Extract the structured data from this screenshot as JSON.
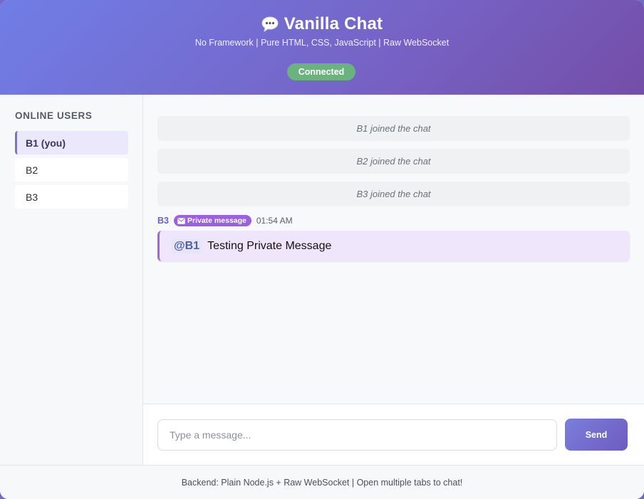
{
  "header": {
    "icon": "speech-bubble-icon",
    "title": "Vanilla Chat",
    "subtitle": "No Framework | Pure HTML, CSS, JavaScript | Raw WebSocket",
    "status": "Connected",
    "status_color": "#6ab37f"
  },
  "sidebar": {
    "heading": "ONLINE USERS",
    "users": [
      {
        "label": "B1 (you)",
        "active": true
      },
      {
        "label": "B2",
        "active": false
      },
      {
        "label": "B3",
        "active": false
      }
    ]
  },
  "messages": {
    "system": [
      "B1 joined the chat",
      "B2 joined the chat",
      "B3 joined the chat"
    ],
    "private": {
      "author": "B3",
      "badge_icon": "envelope-icon",
      "badge": "Private message",
      "time": "01:54 AM",
      "mention": "@B1",
      "text": "Testing Private Message"
    }
  },
  "composer": {
    "placeholder": "Type a message...",
    "value": "",
    "send_label": "Send"
  },
  "footer": {
    "text": "Backend: Plain Node.js + Raw WebSocket | Open multiple tabs to chat!"
  },
  "colors": {
    "accent": "#7673d6",
    "private_accent": "#9b5fe0"
  }
}
